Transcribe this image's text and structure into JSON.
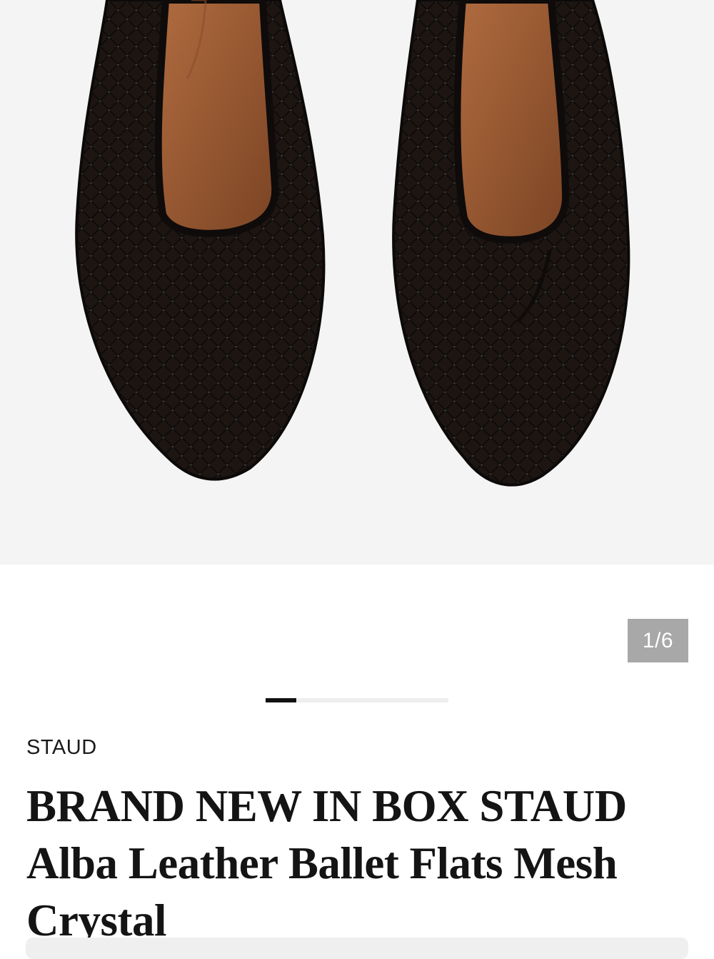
{
  "gallery": {
    "image_alt": "STAUD Alba mesh crystal ballet flats, top view",
    "counter": "1/6",
    "progress": {
      "current": 1,
      "total": 6
    },
    "shoe_colors": {
      "mesh": "#171310",
      "lining": "#9a5a33",
      "dots": "#3a3a3a"
    }
  },
  "product": {
    "brand": "STAUD",
    "title": "BRAND NEW IN BOX STAUD Alba Leather Ballet Flats Mesh Crystal"
  }
}
